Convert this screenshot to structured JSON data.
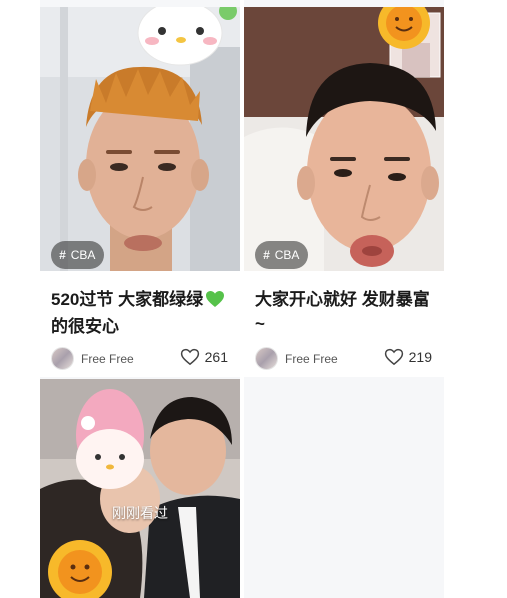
{
  "feed": {
    "cards": [
      {
        "tag": "CBA",
        "title": "520过节 大家都绿绿",
        "title_suffix": "的很安心",
        "author": "Free Free",
        "likes": "261"
      },
      {
        "tag": "CBA",
        "title": "大家开心就好 发财暴富 ~",
        "author": "Free Free",
        "likes": "219"
      },
      {
        "overlay_text": "刚刚看过"
      }
    ]
  },
  "colors": {
    "background": "#f6f7f9",
    "title_text": "#1b1b1b",
    "tag_background": "rgba(40,40,40,0.55)"
  },
  "icons": [
    "hashtag-icon",
    "green-heart-emoji-icon",
    "heart-outline-icon",
    "avatar"
  ]
}
